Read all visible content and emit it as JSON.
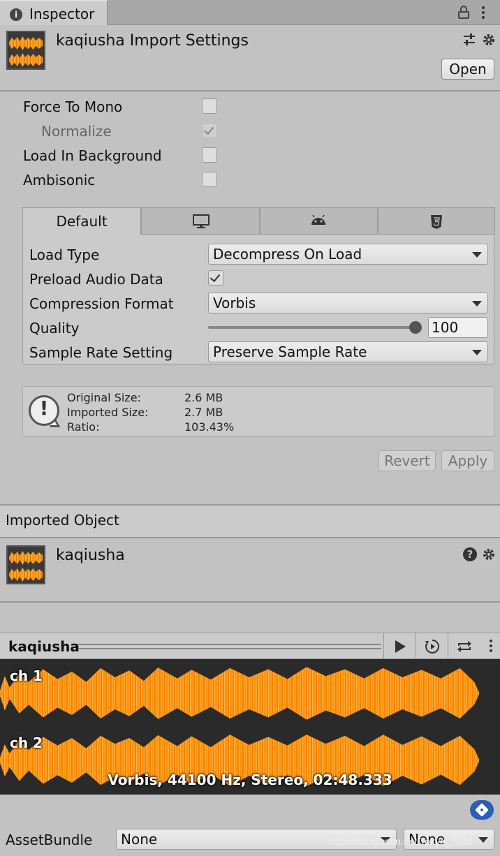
{
  "tab": {
    "title": "Inspector"
  },
  "header": {
    "title": "kaqiusha Import Settings",
    "open_button": "Open"
  },
  "options": [
    {
      "label": "Force To Mono",
      "checked": false,
      "disabled": false
    },
    {
      "label": "Normalize",
      "checked": true,
      "disabled": true
    },
    {
      "label": "Load In Background",
      "checked": false,
      "disabled": false
    },
    {
      "label": "Ambisonic",
      "checked": false,
      "disabled": false
    }
  ],
  "platform": {
    "tabs": [
      {
        "label": "Default",
        "icon": ""
      },
      {
        "label": "",
        "icon": "monitor-icon"
      },
      {
        "label": "",
        "icon": "android-icon"
      },
      {
        "label": "",
        "icon": "html5-icon"
      }
    ],
    "load_type": {
      "label": "Load Type",
      "value": "Decompress On Load"
    },
    "preload": {
      "label": "Preload Audio Data",
      "checked": true
    },
    "compression": {
      "label": "Compression Format",
      "value": "Vorbis"
    },
    "quality": {
      "label": "Quality",
      "value": "100",
      "slider_fraction": 1.0
    },
    "sample_rate": {
      "label": "Sample Rate Setting",
      "value": "Preserve Sample Rate"
    }
  },
  "size_info": {
    "original_label": "Original Size:",
    "original_value": "2.6 MB",
    "imported_label": "Imported Size:",
    "imported_value": "2.7 MB",
    "ratio_label": "Ratio:",
    "ratio_value": "103.43%"
  },
  "actions": {
    "revert": "Revert",
    "apply": "Apply"
  },
  "imported_object": {
    "section_title": "Imported Object",
    "name": "kaqiusha"
  },
  "preview": {
    "name": "kaqiusha",
    "channels": [
      "ch 1",
      "ch 2"
    ],
    "info": "Vorbis, 44100 Hz, Stereo, 02:48.333"
  },
  "asset_bundle": {
    "label": "AssetBundle",
    "value": "None",
    "variant": "None"
  },
  "watermark": "https://blog.csdn.net/Tokyo_2024",
  "colors": {
    "waveform": "#ff9410",
    "waveform_bg": "#2a2a2a",
    "tag_badge": "#2b5fb3"
  }
}
